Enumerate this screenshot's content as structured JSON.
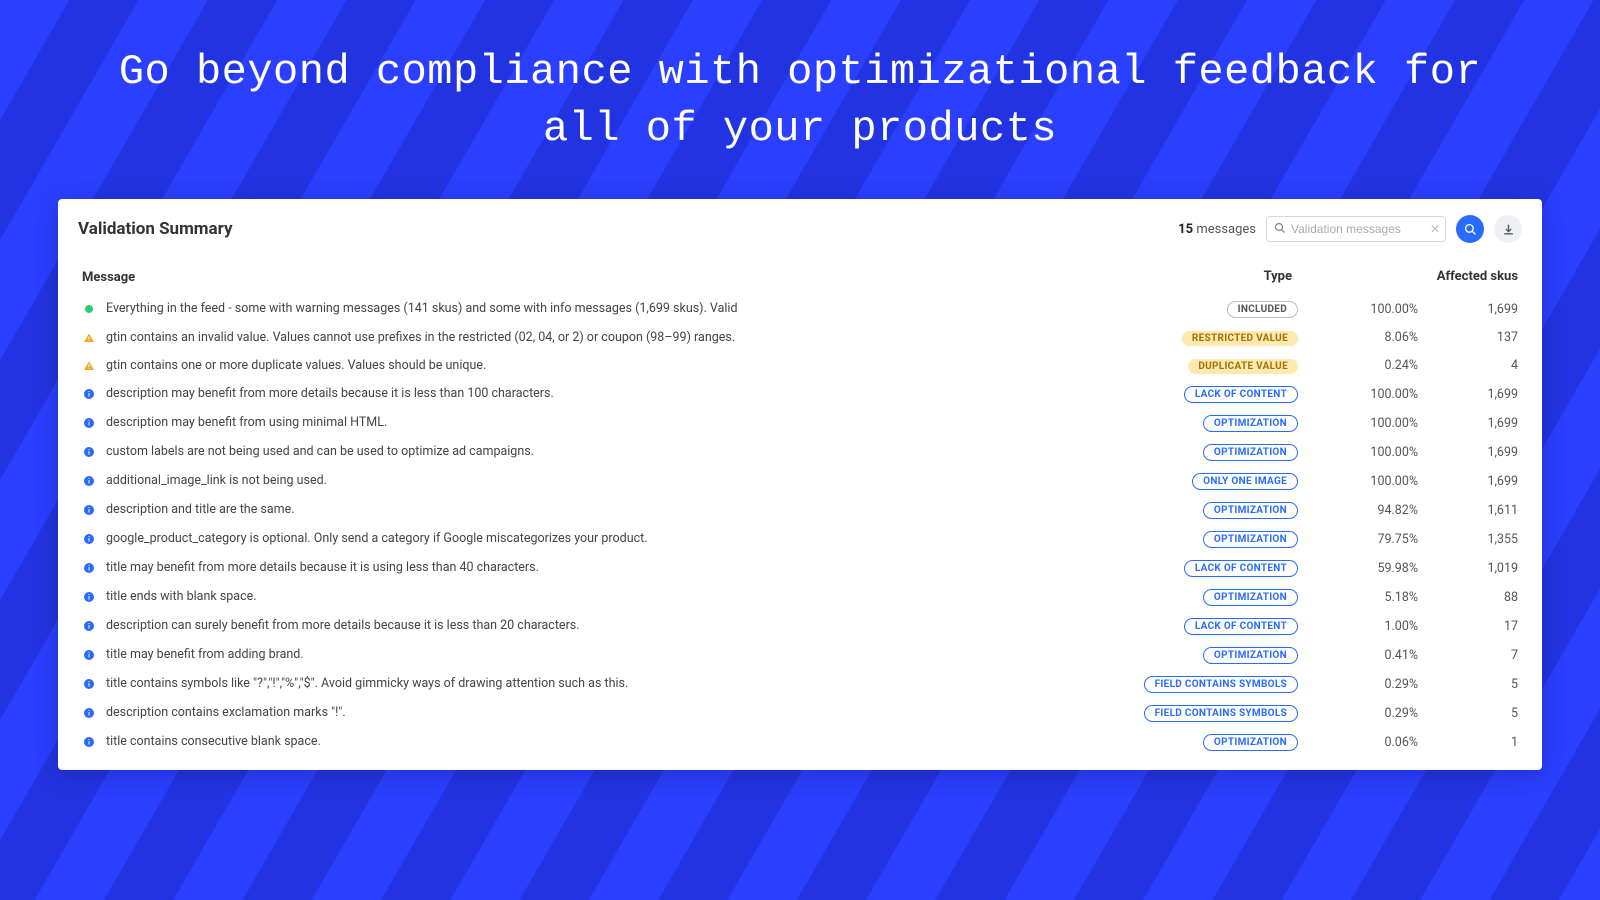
{
  "hero": {
    "title": "Go beyond compliance with optimizational feedback for all of your products"
  },
  "panel": {
    "title": "Validation Summary",
    "messages_count": "15",
    "messages_label": "messages",
    "search_placeholder": "Validation messages"
  },
  "columns": {
    "message": "Message",
    "type": "Type",
    "affected": "Affected skus"
  },
  "tag_labels": {
    "included": "INCLUDED",
    "restricted": "RESTRICTED VALUE",
    "duplicate": "DUPLICATE VALUE",
    "lack": "LACK OF CONTENT",
    "opt": "OPTIMIZATION",
    "oneimg": "ONLY ONE IMAGE",
    "symbols": "FIELD CONTAINS SYMBOLS"
  },
  "rows": [
    {
      "icon": "success",
      "message": "Everything in the feed - some with warning messages (141 skus) and some with info messages (1,699 skus). Valid",
      "type": "included",
      "pct": "100.00%",
      "skus": "1,699"
    },
    {
      "icon": "warning",
      "message": "gtin contains an invalid value. Values cannot use prefixes in the restricted (02, 04, or 2) or coupon (98–99) ranges.",
      "type": "restricted",
      "pct": "8.06%",
      "skus": "137"
    },
    {
      "icon": "warning",
      "message": "gtin contains one or more duplicate values. Values should be unique.",
      "type": "duplicate",
      "pct": "0.24%",
      "skus": "4"
    },
    {
      "icon": "info",
      "message": "description may benefit from more details because it is less than 100 characters.",
      "type": "lack",
      "pct": "100.00%",
      "skus": "1,699"
    },
    {
      "icon": "info",
      "message": "description may benefit from using minimal HTML.",
      "type": "opt",
      "pct": "100.00%",
      "skus": "1,699"
    },
    {
      "icon": "info",
      "message": "custom labels are not being used and can be used to optimize ad campaigns.",
      "type": "opt",
      "pct": "100.00%",
      "skus": "1,699"
    },
    {
      "icon": "info",
      "message": "additional_image_link is not being used.",
      "type": "oneimg",
      "pct": "100.00%",
      "skus": "1,699"
    },
    {
      "icon": "info",
      "message": "description and title are the same.",
      "type": "opt",
      "pct": "94.82%",
      "skus": "1,611"
    },
    {
      "icon": "info",
      "message": "google_product_category is optional. Only send a category if Google miscategorizes your product.",
      "type": "opt",
      "pct": "79.75%",
      "skus": "1,355"
    },
    {
      "icon": "info",
      "message": "title may benefit from more details because it is using less than 40 characters.",
      "type": "lack",
      "pct": "59.98%",
      "skus": "1,019"
    },
    {
      "icon": "info",
      "message": "title ends with blank space.",
      "type": "opt",
      "pct": "5.18%",
      "skus": "88"
    },
    {
      "icon": "info",
      "message": "description can surely benefit from more details because it is less than 20 characters.",
      "type": "lack",
      "pct": "1.00%",
      "skus": "17"
    },
    {
      "icon": "info",
      "message": "title may benefit from adding brand.",
      "type": "opt",
      "pct": "0.41%",
      "skus": "7"
    },
    {
      "icon": "info",
      "message": "title contains symbols like \"?\",\"!\",\"%\",\"$\". Avoid gimmicky ways of drawing attention such as this.",
      "type": "symbols",
      "pct": "0.29%",
      "skus": "5"
    },
    {
      "icon": "info",
      "message": "description contains exclamation marks \"!\".",
      "type": "symbols",
      "pct": "0.29%",
      "skus": "5"
    },
    {
      "icon": "info",
      "message": "title contains consecutive blank space.",
      "type": "opt",
      "pct": "0.06%",
      "skus": "1"
    }
  ]
}
